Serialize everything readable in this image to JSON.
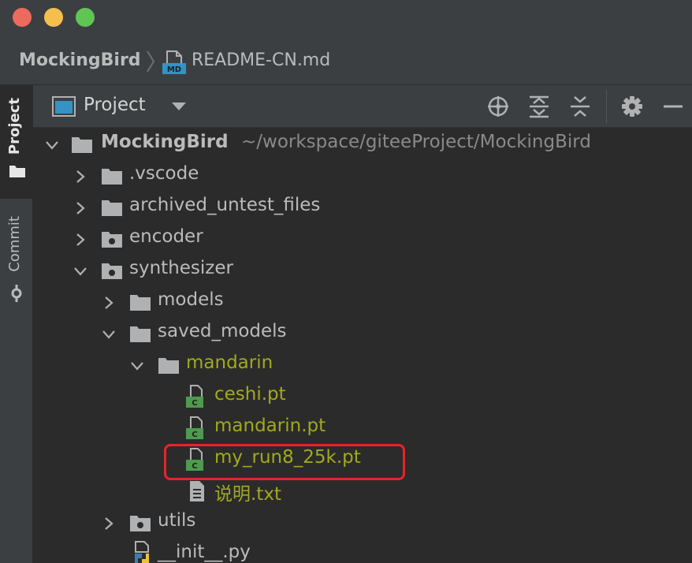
{
  "window": {
    "traffic_lights": [
      "close",
      "minimize",
      "zoom"
    ]
  },
  "navbar": {
    "project": "MockingBird",
    "file": "README-CN.md",
    "file_badge": "MD"
  },
  "side_stripe": {
    "tabs": [
      {
        "label": "Project",
        "active": true
      },
      {
        "label": "Commit",
        "active": false
      }
    ]
  },
  "toolbar": {
    "title": "Project",
    "buttons": [
      "locate-icon",
      "expand-all-icon",
      "collapse-all-icon",
      "gear-icon",
      "hide-icon"
    ]
  },
  "tree": {
    "root": {
      "name": "MockingBird",
      "path": "~/workspace/giteeProject/MockingBird"
    },
    "items": [
      {
        "name": ".vscode",
        "type": "folder",
        "expanded": false
      },
      {
        "name": "archived_untest_files",
        "type": "folder",
        "expanded": false
      },
      {
        "name": "encoder",
        "type": "package",
        "expanded": false
      },
      {
        "name": "synthesizer",
        "type": "package",
        "expanded": true
      },
      {
        "name": "models",
        "type": "folder",
        "expanded": false
      },
      {
        "name": "saved_models",
        "type": "folder",
        "expanded": true
      },
      {
        "name": "mandarin",
        "type": "folder",
        "expanded": true,
        "status": "unversioned"
      },
      {
        "name": "ceshi.pt",
        "type": "file",
        "status": "unversioned"
      },
      {
        "name": "mandarin.pt",
        "type": "file",
        "status": "unversioned"
      },
      {
        "name": "my_run8_25k.pt",
        "type": "file",
        "status": "unversioned",
        "annotated": true
      },
      {
        "name": "说明.txt",
        "type": "text",
        "status": "unversioned"
      },
      {
        "name": "utils",
        "type": "package",
        "expanded": false
      },
      {
        "name": "__init__.py",
        "type": "python"
      }
    ],
    "file_badge": "C"
  },
  "colors": {
    "unversioned": "#a2a91e",
    "annotation": "#e8232a",
    "file_badge": "#4e9a4e"
  }
}
